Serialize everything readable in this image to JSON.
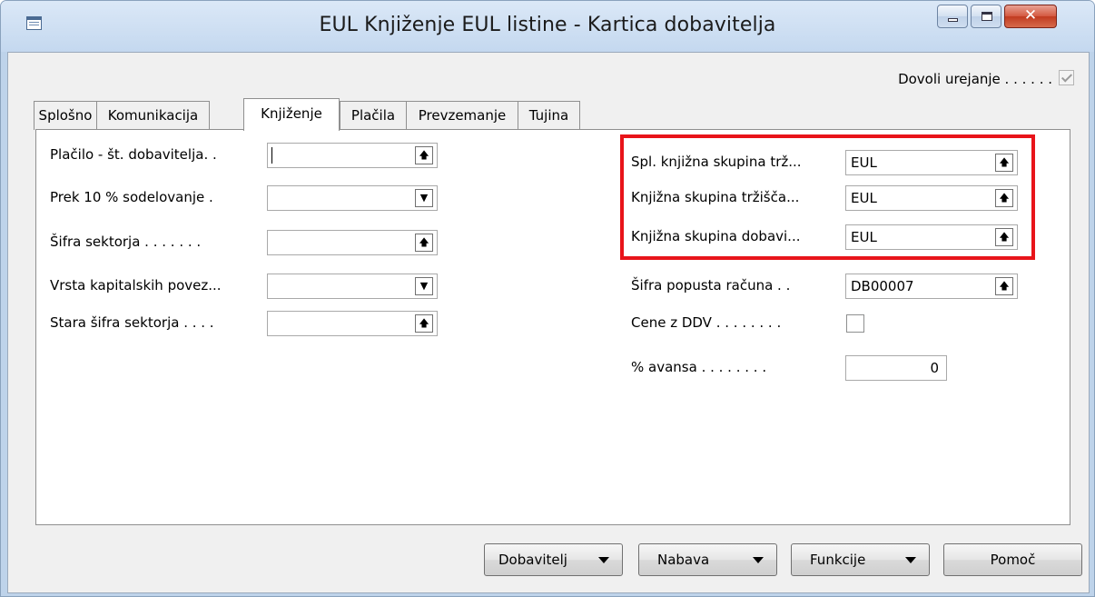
{
  "window": {
    "title": "EUL Knjiženje EUL listine - Kartica dobavitelja",
    "close_glyph": "✕"
  },
  "allow_edit": {
    "label": "Dovoli urejanje . . . . . .",
    "checked": true
  },
  "tabs": [
    {
      "label": "Splošno",
      "active": false
    },
    {
      "label": "Komunikacija",
      "active": false
    },
    {
      "label": "Knjiženje",
      "active": true
    },
    {
      "label": "Plačila",
      "active": false
    },
    {
      "label": "Prevzemanje",
      "active": false
    },
    {
      "label": "Tujina",
      "active": false
    }
  ],
  "left_fields": [
    {
      "label": "Plačilo - št. dobavitelja. .",
      "value": "",
      "button": "up-arrow-icon",
      "focused": true
    },
    {
      "label": "Prek 10 % sodelovanje .",
      "value": "",
      "button": "dropdown-icon"
    },
    {
      "label": "Šifra sektorja . . . . . . .",
      "value": "",
      "button": "up-arrow-icon"
    },
    {
      "label": "Vrsta kapitalskih povez...",
      "value": "",
      "button": "dropdown-icon"
    },
    {
      "label": "Stara šifra sektorja . . . .",
      "value": "",
      "button": "up-arrow-icon"
    }
  ],
  "right_fields": [
    {
      "label": "Spl. knjižna skupina trž...",
      "value": "EUL",
      "button": "up-arrow-icon"
    },
    {
      "label": "Knjižna skupina tržišča...",
      "value": "EUL",
      "button": "up-arrow-icon"
    },
    {
      "label": "Knjižna skupina dobavi...",
      "value": "EUL",
      "button": "up-arrow-icon"
    },
    {
      "label": "Šifra popusta računa . .",
      "value": "DB00007",
      "button": "up-arrow-icon"
    },
    {
      "label": "Cene z DDV . . . . . . . .",
      "checkbox": true,
      "checked": false
    },
    {
      "label": "% avansa . . . . . . . .",
      "value": "0",
      "numeric": true
    }
  ],
  "highlight": {
    "color": "#e8141a"
  },
  "buttons": [
    {
      "label": "Dobavitelj",
      "dropdown": true
    },
    {
      "label": "Nabava",
      "dropdown": true
    },
    {
      "label": "Funkcije",
      "dropdown": true
    },
    {
      "label": "Pomoč",
      "dropdown": false
    }
  ]
}
